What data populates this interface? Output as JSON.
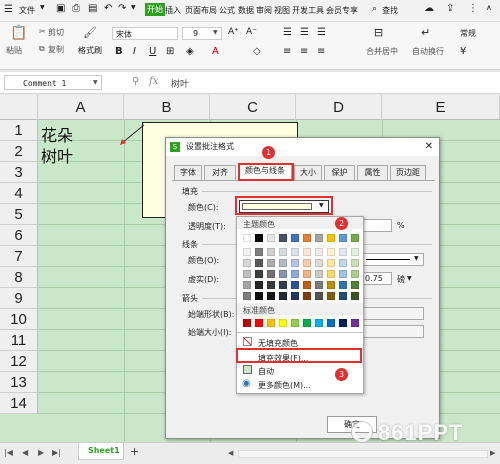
{
  "menu": {
    "file": "文件",
    "items": [
      "开始",
      "插入",
      "页面布局",
      "公式",
      "数据",
      "审阅",
      "视图",
      "开发工具",
      "会员专享"
    ],
    "search": "查找"
  },
  "ribbon": {
    "paste": "粘贴",
    "cut": "剪切",
    "copy": "复制",
    "format_painter": "格式刷",
    "font_name": "宋体",
    "font_size": "9",
    "merge": "合并居中",
    "wrap": "自动换行",
    "number_format": "常规"
  },
  "formula_bar": {
    "name_box": "Comment 1",
    "fx": "fx",
    "content": "树叶"
  },
  "sheet": {
    "columns": [
      "A",
      "B",
      "C",
      "D",
      "E"
    ],
    "rows": [
      "1",
      "2",
      "3",
      "4",
      "5",
      "6",
      "7",
      "8",
      "9",
      "10",
      "11",
      "12",
      "13",
      "14"
    ],
    "a1": "花朵",
    "a2": "树叶",
    "tab": "Sheet1",
    "add": "+"
  },
  "dialog": {
    "title": "设置批注格式",
    "tabs": [
      "字体",
      "对齐",
      "颜色与线条",
      "大小",
      "保护",
      "属性",
      "页边距"
    ],
    "fill_section": "填充",
    "color_label": "颜色(C):",
    "transparency_label": "透明度(T):",
    "percent": "%",
    "line_section": "线条",
    "line_color_label": "颜色(O):",
    "dash_label": "虚实(D):",
    "weight_value": "0.75",
    "weight_unit": "磅",
    "arrow_section": "箭头",
    "begin_style_label": "始端形状(B):",
    "begin_size_label": "始端大小(I):",
    "ok": "确定"
  },
  "palette": {
    "theme_colors_label": "主题颜色",
    "standard_colors_label": "标准颜色",
    "no_fill": "无填充颜色",
    "fill_effects": "填充效果(F)...",
    "automatic": "自动",
    "more_colors": "更多颜色(M)...",
    "theme_top": [
      "#ffffff",
      "#000000",
      "#e7e6e6",
      "#44546a",
      "#4472c4",
      "#ed7d31",
      "#a5a5a5",
      "#ffc000",
      "#5b9bd5",
      "#70ad47"
    ],
    "theme_shades": [
      [
        "#f2f2f2",
        "#7f7f7f",
        "#d0cece",
        "#d6dce4",
        "#d9e2f3",
        "#fbe4d5",
        "#ededed",
        "#fff2cc",
        "#deebf6",
        "#e2efd9"
      ],
      [
        "#d8d8d8",
        "#595959",
        "#aeabab",
        "#adb9ca",
        "#b4c6e7",
        "#f7cbac",
        "#dbdbdb",
        "#fee599",
        "#bdd7ee",
        "#c5e0b3"
      ],
      [
        "#bfbfbf",
        "#3f3f3f",
        "#757070",
        "#8496b0",
        "#8eaadb",
        "#f4b183",
        "#c9c9c9",
        "#ffd965",
        "#9dc3e6",
        "#a8d08d"
      ],
      [
        "#a5a5a5",
        "#262626",
        "#3a3838",
        "#323f4f",
        "#2f5496",
        "#c55a11",
        "#7b7b7b",
        "#bf8f00",
        "#2e75b5",
        "#538135"
      ],
      [
        "#7f7f7f",
        "#0d0d0d",
        "#171616",
        "#222a35",
        "#1f3864",
        "#833c0b",
        "#525252",
        "#7f6000",
        "#1e4e79",
        "#375623"
      ]
    ],
    "standard": [
      "#c00000",
      "#ff0000",
      "#ffc000",
      "#ffff00",
      "#92d050",
      "#00b050",
      "#00b0f0",
      "#0070c0",
      "#002060",
      "#7030a0"
    ]
  },
  "annotations": {
    "badge1": "1",
    "badge2": "2",
    "badge3": "3"
  },
  "watermark": "861PPT",
  "colors": {
    "grid_bg": "#c9e7c9",
    "accent_red": "#e03030",
    "wps_green": "#2ea121",
    "comment_fill": "#ffffe1"
  }
}
